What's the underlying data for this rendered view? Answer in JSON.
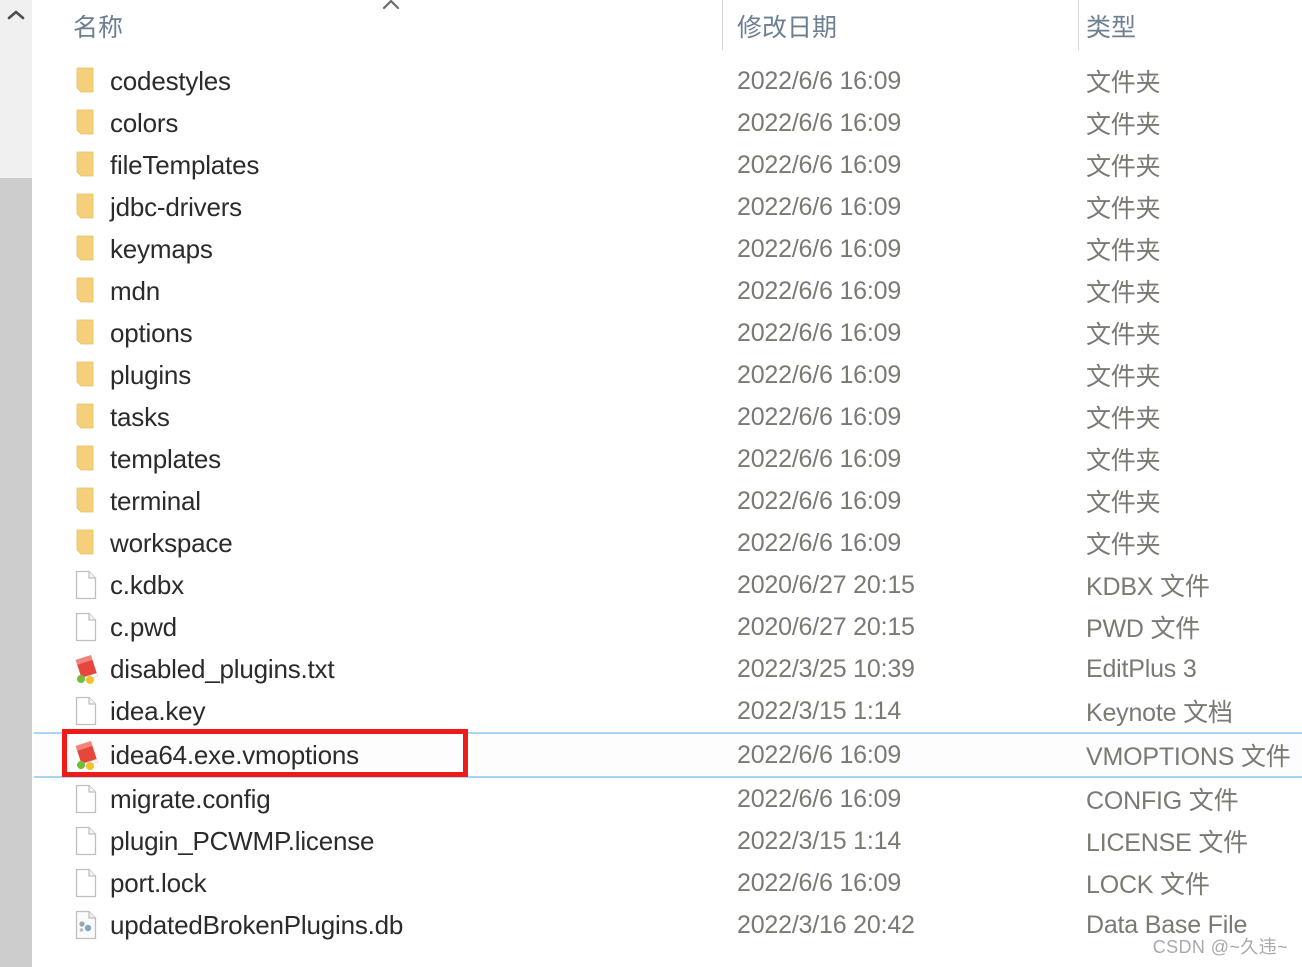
{
  "window": {
    "scrollbar": {
      "up_arrow_icon": "chevron-up-icon"
    },
    "sort_indicator_icon": "sort-ascending-chevron-icon"
  },
  "columns": {
    "name": "名称",
    "date_modified": "修改日期",
    "type": "类型"
  },
  "rows": [
    {
      "name": "codestyles",
      "date": "2022/6/6 16:09",
      "type": "文件夹",
      "icon": "folder-icon",
      "selected": false
    },
    {
      "name": "colors",
      "date": "2022/6/6 16:09",
      "type": "文件夹",
      "icon": "folder-icon",
      "selected": false
    },
    {
      "name": "fileTemplates",
      "date": "2022/6/6 16:09",
      "type": "文件夹",
      "icon": "folder-icon",
      "selected": false
    },
    {
      "name": "jdbc-drivers",
      "date": "2022/6/6 16:09",
      "type": "文件夹",
      "icon": "folder-icon",
      "selected": false
    },
    {
      "name": "keymaps",
      "date": "2022/6/6 16:09",
      "type": "文件夹",
      "icon": "folder-icon",
      "selected": false
    },
    {
      "name": "mdn",
      "date": "2022/6/6 16:09",
      "type": "文件夹",
      "icon": "folder-icon",
      "selected": false
    },
    {
      "name": "options",
      "date": "2022/6/6 16:09",
      "type": "文件夹",
      "icon": "folder-icon",
      "selected": false
    },
    {
      "name": "plugins",
      "date": "2022/6/6 16:09",
      "type": "文件夹",
      "icon": "folder-icon",
      "selected": false
    },
    {
      "name": "tasks",
      "date": "2022/6/6 16:09",
      "type": "文件夹",
      "icon": "folder-icon",
      "selected": false
    },
    {
      "name": "templates",
      "date": "2022/6/6 16:09",
      "type": "文件夹",
      "icon": "folder-icon",
      "selected": false
    },
    {
      "name": "terminal",
      "date": "2022/6/6 16:09",
      "type": "文件夹",
      "icon": "folder-icon",
      "selected": false
    },
    {
      "name": "workspace",
      "date": "2022/6/6 16:09",
      "type": "文件夹",
      "icon": "folder-icon",
      "selected": false
    },
    {
      "name": "c.kdbx",
      "date": "2020/6/27 20:15",
      "type": "KDBX 文件",
      "icon": "generic-file-icon",
      "selected": false
    },
    {
      "name": "c.pwd",
      "date": "2020/6/27 20:15",
      "type": "PWD 文件",
      "icon": "generic-file-icon",
      "selected": false
    },
    {
      "name": "disabled_plugins.txt",
      "date": "2022/3/25 10:39",
      "type": "EditPlus 3",
      "icon": "editplus-file-icon",
      "selected": false
    },
    {
      "name": "idea.key",
      "date": "2022/3/15 1:14",
      "type": "Keynote 文档",
      "icon": "generic-file-icon",
      "selected": false
    },
    {
      "name": "idea64.exe.vmoptions",
      "date": "2022/6/6 16:09",
      "type": "VMOPTIONS 文件",
      "icon": "editplus-file-icon",
      "selected": true
    },
    {
      "name": "migrate.config",
      "date": "2022/6/6 16:09",
      "type": "CONFIG 文件",
      "icon": "generic-file-icon",
      "selected": false
    },
    {
      "name": "plugin_PCWMP.license",
      "date": "2022/3/15 1:14",
      "type": "LICENSE 文件",
      "icon": "generic-file-icon",
      "selected": false
    },
    {
      "name": "port.lock",
      "date": "2022/6/6 16:09",
      "type": "LOCK 文件",
      "icon": "generic-file-icon",
      "selected": false
    },
    {
      "name": "updatedBrokenPlugins.db",
      "date": "2022/3/16 20:42",
      "type": "Data Base File",
      "icon": "database-file-icon",
      "selected": false
    }
  ],
  "annotation": {
    "highlight_box_color": "#ef1b1b",
    "target_row_name": "idea64.exe.vmoptions"
  },
  "watermark": {
    "text": "CSDN @~久违~"
  }
}
